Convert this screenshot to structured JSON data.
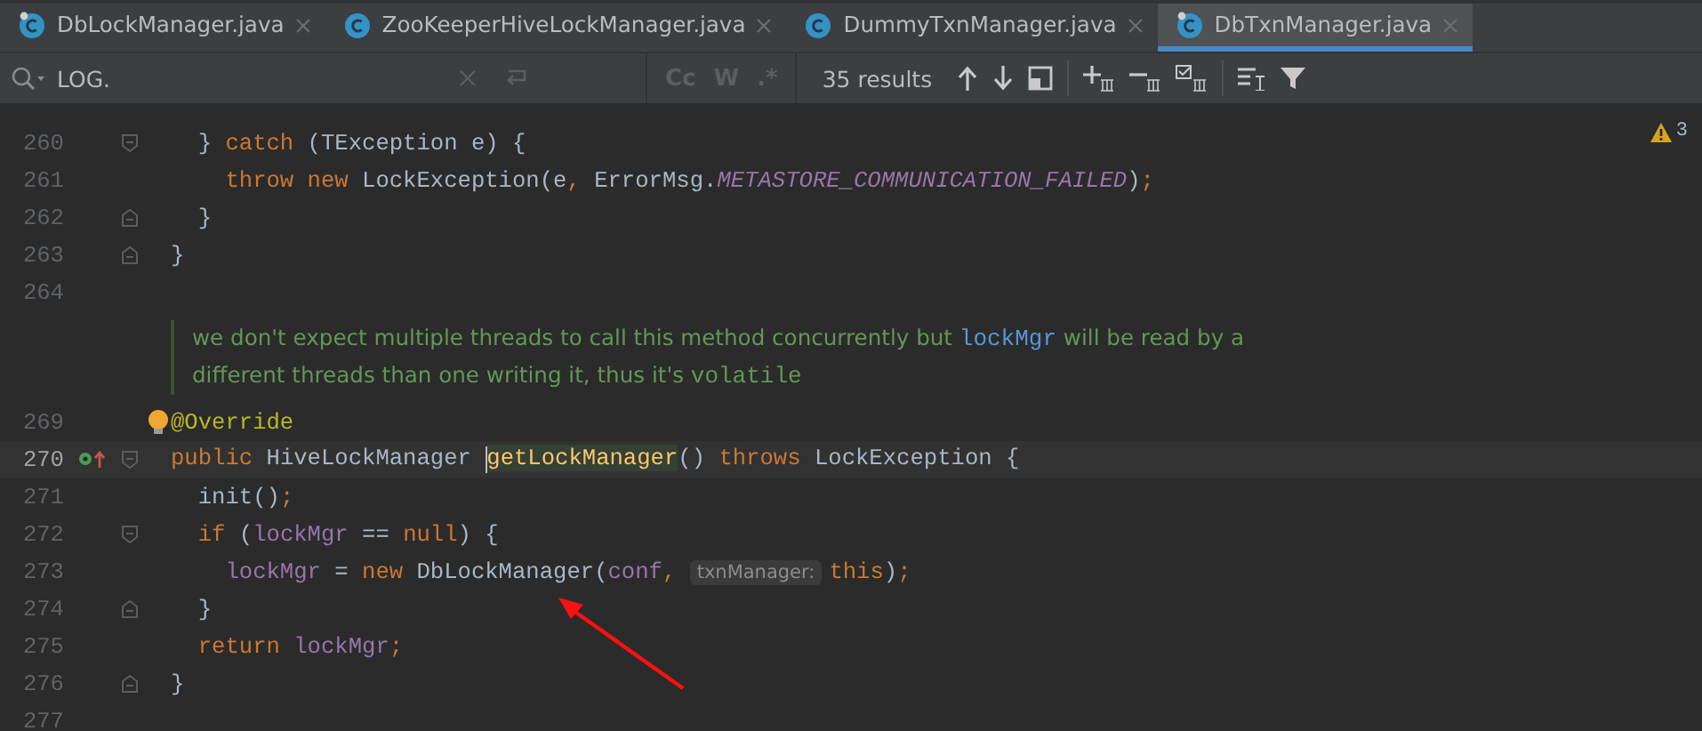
{
  "tabs": [
    {
      "label": "DbLockManager.java",
      "selected": false,
      "pinned": true
    },
    {
      "label": "ZooKeeperHiveLockManager.java",
      "selected": false,
      "pinned": false
    },
    {
      "label": "DummyTxnManager.java",
      "selected": false,
      "pinned": false
    },
    {
      "label": "DbTxnManager.java",
      "selected": true,
      "pinned": true
    }
  ],
  "search": {
    "value": "LOG.",
    "options": [
      {
        "label": "Cc",
        "selected": false
      },
      {
        "label": "W",
        "selected": false
      },
      {
        "label": ".*",
        "selected": false
      }
    ],
    "results": "35 results"
  },
  "warnings": "3",
  "lines_before": [
    {
      "number": "260",
      "current": false,
      "fold_start": true,
      "fold_end": false,
      "override": false,
      "bulb": false,
      "tokens": [
        {
          "kind": "plain",
          "text": "  } "
        },
        {
          "kind": "kw",
          "text": "catch "
        },
        {
          "kind": "plain",
          "text": "(TException e) {"
        }
      ]
    },
    {
      "number": "261",
      "current": false,
      "fold_start": false,
      "fold_end": false,
      "override": false,
      "bulb": false,
      "tokens": [
        {
          "kind": "kw",
          "text": "    throw new "
        },
        {
          "kind": "plain",
          "text": "LockException(e"
        },
        {
          "kind": "kw",
          "text": ", "
        },
        {
          "kind": "plain",
          "text": "ErrorMsg."
        },
        {
          "kind": "static",
          "text": "METASTORE_COMMUNICATION_FAILED"
        },
        {
          "kind": "plain",
          "text": ")"
        },
        {
          "kind": "kw",
          "text": ";"
        }
      ]
    },
    {
      "number": "262",
      "current": false,
      "fold_start": false,
      "fold_end": true,
      "override": false,
      "bulb": false,
      "tokens": [
        {
          "kind": "plain",
          "text": "  }"
        }
      ]
    },
    {
      "number": "263",
      "current": false,
      "fold_start": false,
      "fold_end": true,
      "override": false,
      "bulb": false,
      "tokens": [
        {
          "kind": "plain",
          "text": "}"
        }
      ]
    },
    {
      "number": "264",
      "current": false,
      "fold_start": false,
      "fold_end": false,
      "override": false,
      "bulb": false
    }
  ],
  "doc": [
    {
      "kind": "text",
      "text": "we don't expect multiple threads to call this method concurrently but "
    },
    {
      "kind": "code",
      "text": "lockMgr"
    },
    {
      "kind": "text",
      "text": " will be read by a different threads than one writing it, thus it's "
    },
    {
      "kind": "mono",
      "text": "volatile"
    }
  ],
  "lines_after": [
    {
      "number": "269",
      "current": false,
      "fold_start": false,
      "fold_end": false,
      "override": false,
      "bulb": true,
      "tokens": [
        {
          "kind": "annotation",
          "text": "@Override"
        }
      ]
    },
    {
      "number": "270",
      "current": true,
      "fold_start": true,
      "fold_end": false,
      "override": true,
      "bulb": false,
      "tokens": [
        {
          "kind": "kw",
          "text": "public "
        },
        {
          "kind": "plain",
          "text": "HiveLockManager "
        },
        {
          "kind": "method",
          "text": "getLockManager"
        },
        {
          "kind": "plain",
          "text": "() "
        },
        {
          "kind": "kw",
          "text": "throws "
        },
        {
          "kind": "plain",
          "text": "LockException {"
        }
      ]
    },
    {
      "number": "271",
      "current": false,
      "fold_start": false,
      "fold_end": false,
      "override": false,
      "bulb": false,
      "tokens": [
        {
          "kind": "plain",
          "text": "  init()"
        },
        {
          "kind": "kw",
          "text": ";"
        }
      ]
    },
    {
      "number": "272",
      "current": false,
      "fold_start": true,
      "fold_end": false,
      "override": false,
      "bulb": false,
      "tokens": [
        {
          "kind": "kw",
          "text": "  if "
        },
        {
          "kind": "plain",
          "text": "("
        },
        {
          "kind": "field",
          "text": "lockMgr "
        },
        {
          "kind": "plain",
          "text": "== "
        },
        {
          "kind": "kw",
          "text": "null"
        },
        {
          "kind": "plain",
          "text": ") {"
        }
      ]
    },
    {
      "number": "273",
      "current": false,
      "fold_start": false,
      "fold_end": false,
      "override": false,
      "bulb": false,
      "tokens": [
        {
          "kind": "field",
          "text": "    lockMgr "
        },
        {
          "kind": "plain",
          "text": "= "
        },
        {
          "kind": "kw",
          "text": "new "
        },
        {
          "kind": "plain",
          "text": "DbLockManager("
        },
        {
          "kind": "field",
          "text": "conf"
        },
        {
          "kind": "kw",
          "text": ", "
        },
        {
          "kind": "hint",
          "text": "txnManager:"
        },
        {
          "kind": "kw",
          "text": "this"
        },
        {
          "kind": "plain",
          "text": ")"
        },
        {
          "kind": "kw",
          "text": ";"
        }
      ]
    },
    {
      "number": "274",
      "current": false,
      "fold_start": false,
      "fold_end": true,
      "override": false,
      "bulb": false,
      "tokens": [
        {
          "kind": "plain",
          "text": "  }"
        }
      ]
    },
    {
      "number": "275",
      "current": false,
      "fold_start": false,
      "fold_end": false,
      "override": false,
      "bulb": false,
      "tokens": [
        {
          "kind": "kw",
          "text": "  return "
        },
        {
          "kind": "field",
          "text": "lockMgr"
        },
        {
          "kind": "kw",
          "text": ";"
        }
      ]
    },
    {
      "number": "276",
      "current": false,
      "fold_start": false,
      "fold_end": true,
      "override": false,
      "bulb": false,
      "tokens": [
        {
          "kind": "plain",
          "text": "}"
        }
      ]
    },
    {
      "number": "277",
      "current": false,
      "fold_start": false,
      "fold_end": false,
      "override": false,
      "bulb": false
    }
  ]
}
